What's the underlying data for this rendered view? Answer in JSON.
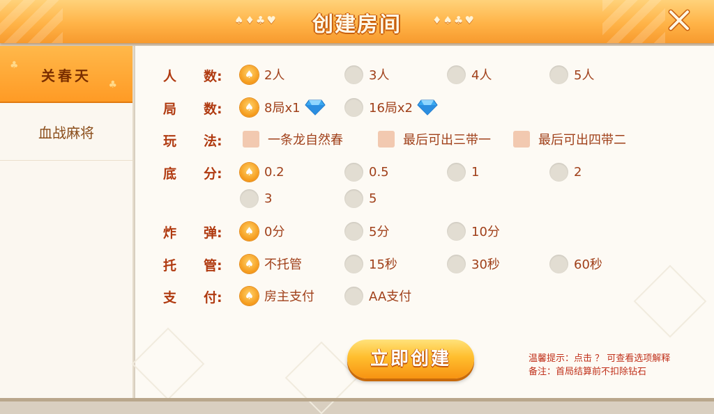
{
  "header": {
    "title": "创建房间",
    "deco_left": "♠♦♣♥",
    "deco_right": "♦♠♣♥"
  },
  "sidebar": {
    "items": [
      {
        "label": "关春天",
        "active": true
      },
      {
        "label": "血战麻将",
        "active": false
      }
    ]
  },
  "settings": {
    "players": {
      "label1": "人",
      "label2": "数:",
      "options": [
        "2人",
        "3人",
        "4人",
        "5人"
      ],
      "selected": 0
    },
    "rounds": {
      "label1": "局",
      "label2": "数:",
      "options": [
        "8局x1",
        "16局x2"
      ],
      "selected": 0,
      "cost_icon": "diamond-icon"
    },
    "rules": {
      "label1": "玩",
      "label2": "法:",
      "options": [
        "一条龙自然春",
        "最后可出三带一",
        "最后可出四带二"
      ]
    },
    "base": {
      "label1": "底",
      "label2": "分:",
      "options": [
        "0.2",
        "0.5",
        "1",
        "2",
        "3",
        "5"
      ],
      "selected": 0
    },
    "bomb": {
      "label1": "炸",
      "label2": "弹:",
      "options": [
        "0分",
        "5分",
        "10分"
      ],
      "selected": 0
    },
    "trustee": {
      "label1": "托",
      "label2": "管:",
      "options": [
        "不托管",
        "15秒",
        "30秒",
        "60秒"
      ],
      "selected": 0
    },
    "payment": {
      "label1": "支",
      "label2": "付:",
      "options": [
        "房主支付",
        "AA支付"
      ],
      "selected": 0
    }
  },
  "actions": {
    "create_label": "立即创建"
  },
  "notes": {
    "line1": "温馨提示：点击 ？ 可查看选项解释",
    "line2": "备注：首局结算前不扣除钻石"
  },
  "colors": {
    "accent": "#ff9a24",
    "label_text": "#b03a10",
    "option_text": "#a0401a"
  }
}
